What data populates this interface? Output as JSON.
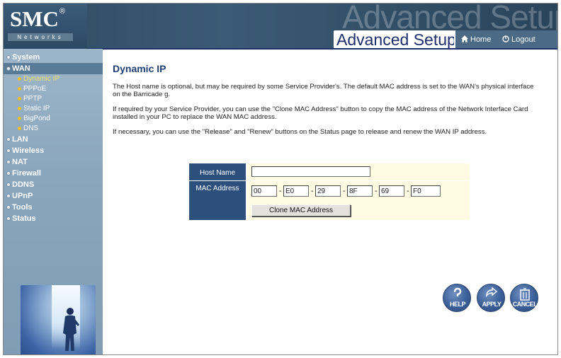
{
  "brand": {
    "logo": "SMC",
    "registered": "®",
    "networks": "Networks"
  },
  "header": {
    "watermark": "Advanced Setup",
    "title": "Advanced Setup",
    "home": "Home",
    "logout": "Logout"
  },
  "sidebar": {
    "items": [
      {
        "label": "System"
      },
      {
        "label": "WAN",
        "sub": [
          "Dynamic IP",
          "PPPoE",
          "PPTP",
          "Static IP",
          "BigPond",
          "DNS"
        ]
      },
      {
        "label": "LAN"
      },
      {
        "label": "Wireless"
      },
      {
        "label": "NAT"
      },
      {
        "label": "Firewall"
      },
      {
        "label": "DDNS"
      },
      {
        "label": "UPnP"
      },
      {
        "label": "Tools"
      },
      {
        "label": "Status"
      }
    ]
  },
  "main": {
    "title": "Dynamic IP",
    "para1": "The Host name is optional, but may be required by some Service Provider's. The default MAC address is set to the WAN's physical interface on the Barricade g.",
    "para2": "If required by your Service Provider, you can use the \"Clone MAC Address\" button to copy the MAC address of the Network Interface Card installed in your PC to replace the WAN MAC address.",
    "para3": "If necessary, you can use the \"Release\" and \"Renew\" buttons on the Status page to release and renew the WAN IP address."
  },
  "form": {
    "host_label": "Host Name",
    "host_value": "",
    "mac_label": "MAC Address",
    "mac": [
      "00",
      "E0",
      "29",
      "8F",
      "69",
      "F0"
    ],
    "clone_button": "Clone MAC Address"
  },
  "actions": {
    "help": "HELP",
    "apply": "APPLY",
    "cancel": "CANCEL"
  }
}
